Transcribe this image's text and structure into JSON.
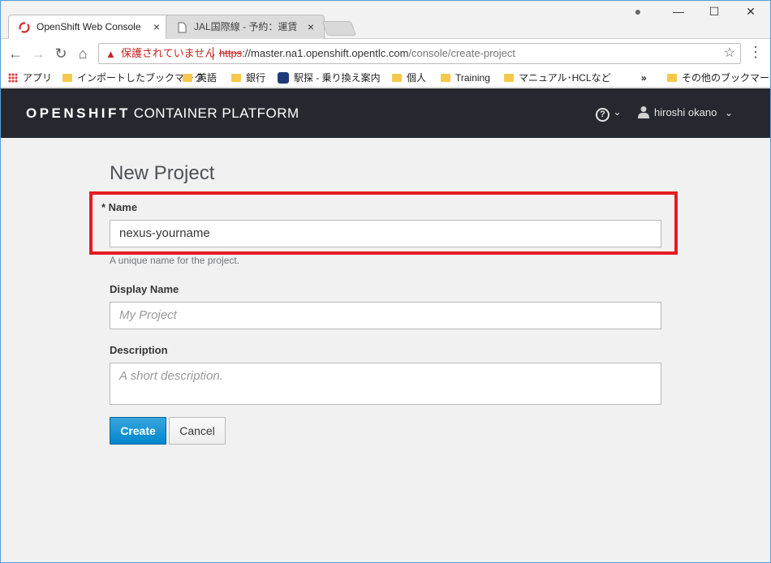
{
  "browser": {
    "tabs": [
      {
        "title": "OpenShift Web Console",
        "close": "×"
      },
      {
        "title": "JAL国際線 - 予約：運賃",
        "close": "×"
      }
    ],
    "window_controls": {
      "account": "●",
      "minimize": "—",
      "maximize": "☐",
      "close": "✕"
    },
    "nav": {
      "back": "←",
      "forward": "→",
      "reload": "↻",
      "home": "⌂"
    },
    "omnibox": {
      "warning_icon": "▲",
      "warning_text": "保護されていません",
      "url_scheme": "https",
      "url_host": "://master.na1.openshift.opentlc.com",
      "url_path": "/console/create-project",
      "star": "☆"
    },
    "menu": "⋮",
    "bookmarks": [
      {
        "label": "アプリ",
        "icon": "apps-grid-icon"
      },
      {
        "label": "インポートしたブックマーク",
        "icon": "folder-icon"
      },
      {
        "label": "英語",
        "icon": "folder-icon"
      },
      {
        "label": "銀行",
        "icon": "folder-icon"
      },
      {
        "label": "駅探 - 乗り換え案内",
        "icon": "ekitan-icon"
      },
      {
        "label": "個人",
        "icon": "folder-icon"
      },
      {
        "label": "Training",
        "icon": "folder-icon"
      },
      {
        "label": "マニュアル･HCLなど",
        "icon": "folder-icon"
      }
    ],
    "bookmarks_overflow": "»",
    "other_bookmarks": "その他のブックマーク"
  },
  "header": {
    "brand_bold": "OPENSHIFT",
    "brand_rest": "CONTAINER PLATFORM",
    "help_icon": "?",
    "caret": "⌄",
    "user_name": "hiroshi okano"
  },
  "form": {
    "title": "New Project",
    "name_label": "* Name",
    "name_value": "nexus-yourname",
    "name_help": "A unique name for the project.",
    "display_name_label": "Display Name",
    "display_name_placeholder": "My Project",
    "description_label": "Description",
    "description_placeholder": "A short description.",
    "create_button": "Create",
    "cancel_button": "Cancel"
  },
  "colors": {
    "header_bg": "#25292f",
    "primary_button": "#0088ce",
    "highlight_box": "#e31b23"
  }
}
